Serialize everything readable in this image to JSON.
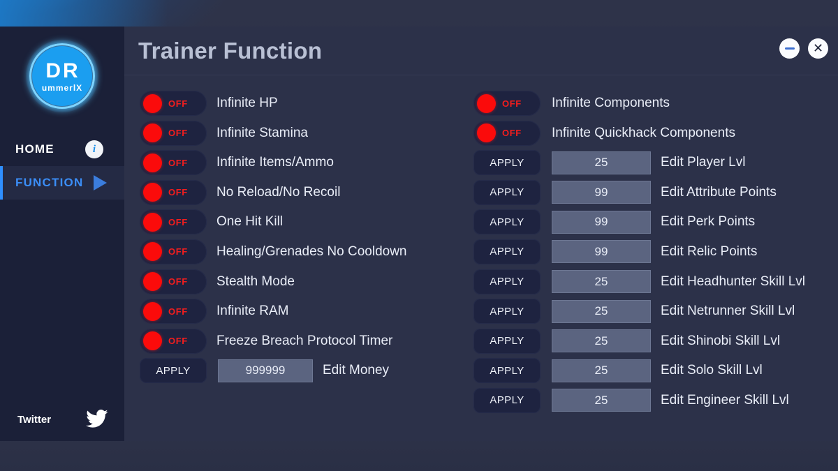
{
  "window": {
    "title": "Trainer Function",
    "minimize_icon": "minimize-icon",
    "close_icon": "close-icon",
    "close_glyph": "✕"
  },
  "sidebar": {
    "logo": {
      "primary": "DR",
      "secondary": "ummerlX"
    },
    "nav": [
      {
        "label": "HOME",
        "badge": "i",
        "active": false
      },
      {
        "label": "FUNCTION",
        "active": true
      }
    ],
    "footer": {
      "label": "Twitter",
      "icon": "twitter-icon"
    }
  },
  "colors": {
    "accent_blue": "#3b8ef7",
    "logo_blue": "#1b9ef0",
    "toggle_red": "#fb0b0b",
    "panel_bg": "#2c3149",
    "sidebar_bg": "#1b2038",
    "input_bg": "#5b6480",
    "title_text": "#b9c0d4"
  },
  "labels": {
    "toggle_off": "OFF",
    "apply": "APPLY"
  },
  "columns": {
    "left": [
      {
        "type": "toggle",
        "state": "OFF",
        "label": "Infinite HP"
      },
      {
        "type": "toggle",
        "state": "OFF",
        "label": "Infinite Stamina"
      },
      {
        "type": "toggle",
        "state": "OFF",
        "label": "Infinite Items/Ammo"
      },
      {
        "type": "toggle",
        "state": "OFF",
        "label": "No Reload/No Recoil"
      },
      {
        "type": "toggle",
        "state": "OFF",
        "label": "One Hit Kill"
      },
      {
        "type": "toggle",
        "state": "OFF",
        "label": "Healing/Grenades No Cooldown"
      },
      {
        "type": "toggle",
        "state": "OFF",
        "label": "Stealth Mode"
      },
      {
        "type": "toggle",
        "state": "OFF",
        "label": "Infinite RAM"
      },
      {
        "type": "toggle",
        "state": "OFF",
        "label": "Freeze Breach Protocol Timer"
      },
      {
        "type": "input",
        "button": "APPLY",
        "value": "999999",
        "label": "Edit Money"
      }
    ],
    "right": [
      {
        "type": "toggle",
        "state": "OFF",
        "label": "Infinite Components"
      },
      {
        "type": "toggle",
        "state": "OFF",
        "label": "Infinite Quickhack Components"
      },
      {
        "type": "input",
        "button": "APPLY",
        "value": "25",
        "label": "Edit Player Lvl"
      },
      {
        "type": "input",
        "button": "APPLY",
        "value": "99",
        "label": "Edit Attribute Points"
      },
      {
        "type": "input",
        "button": "APPLY",
        "value": "99",
        "label": "Edit Perk Points"
      },
      {
        "type": "input",
        "button": "APPLY",
        "value": "99",
        "label": "Edit Relic Points"
      },
      {
        "type": "input",
        "button": "APPLY",
        "value": "25",
        "label": "Edit Headhunter Skill Lvl"
      },
      {
        "type": "input",
        "button": "APPLY",
        "value": "25",
        "label": "Edit Netrunner Skill Lvl"
      },
      {
        "type": "input",
        "button": "APPLY",
        "value": "25",
        "label": "Edit Shinobi Skill Lvl"
      },
      {
        "type": "input",
        "button": "APPLY",
        "value": "25",
        "label": "Edit Solo Skill Lvl"
      },
      {
        "type": "input",
        "button": "APPLY",
        "value": "25",
        "label": "Edit Engineer Skill Lvl"
      }
    ]
  }
}
